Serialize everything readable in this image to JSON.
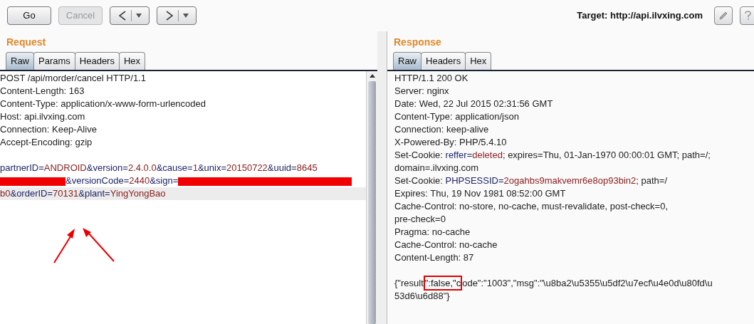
{
  "toolbar": {
    "buttons": [
      {
        "label": "Go",
        "disabled": false
      },
      {
        "label": "Cancel",
        "disabled": true
      }
    ],
    "target": "Target: http://api.ilvxing.com"
  },
  "request": {
    "title": "Request",
    "tabs": [
      {
        "label": "Raw",
        "selected": true
      },
      {
        "label": "Params",
        "selected": false
      },
      {
        "label": "Headers",
        "selected": false
      },
      {
        "label": "Hex",
        "selected": false
      }
    ],
    "lines": [
      {
        "segments": [
          {
            "kind": "plain",
            "text": "POST /api/morder/cancel HTTP/1.1"
          }
        ]
      },
      {
        "segments": [
          {
            "kind": "plain",
            "text": "Content-Length: 163"
          }
        ]
      },
      {
        "segments": [
          {
            "kind": "plain",
            "text": "Content-Type: application/x-www-form-urlencoded"
          }
        ]
      },
      {
        "segments": [
          {
            "kind": "plain",
            "text": "Host: api.ilvxing.com"
          }
        ]
      },
      {
        "segments": [
          {
            "kind": "plain",
            "text": "Connection: Keep-Alive"
          }
        ]
      },
      {
        "segments": [
          {
            "kind": "plain",
            "text": "Accept-Encoding: gzip"
          }
        ]
      },
      {
        "kind": "blank"
      },
      {
        "segments": [
          {
            "kind": "name",
            "text": "partnerID="
          },
          {
            "kind": "value",
            "text": "ANDROID"
          },
          {
            "kind": "name",
            "text": "&version="
          },
          {
            "kind": "value",
            "text": "2.4.0.0"
          },
          {
            "kind": "name",
            "text": "&cause="
          },
          {
            "kind": "value",
            "text": "1"
          },
          {
            "kind": "name",
            "text": "&unix="
          },
          {
            "kind": "value",
            "text": "20150722"
          },
          {
            "kind": "name",
            "text": "&uuid="
          },
          {
            "kind": "value",
            "text": "8645"
          }
        ]
      },
      {
        "segments": [
          {
            "kind": "redaction"
          },
          {
            "kind": "name",
            "text": "&versionCode="
          },
          {
            "kind": "value",
            "text": "2440"
          },
          {
            "kind": "name",
            "text": "&sign="
          },
          {
            "kind": "redaction"
          }
        ]
      },
      {
        "highlighted": true,
        "segments": [
          {
            "kind": "value",
            "text": "b0"
          },
          {
            "kind": "name",
            "text": "&orderID="
          },
          {
            "kind": "value",
            "text": "70131"
          },
          {
            "kind": "name",
            "text": "&plant="
          },
          {
            "kind": "value",
            "text": "YingYongBao"
          }
        ]
      }
    ]
  },
  "response": {
    "title": "Response",
    "tabs": [
      {
        "label": "Raw",
        "selected": true
      },
      {
        "label": "Headers",
        "selected": false
      },
      {
        "label": "Hex",
        "selected": false
      }
    ],
    "lines": [
      {
        "segments": [
          {
            "kind": "plain",
            "text": "HTTP/1.1 200 OK"
          }
        ]
      },
      {
        "segments": [
          {
            "kind": "plain",
            "text": "Server: nginx"
          }
        ]
      },
      {
        "segments": [
          {
            "kind": "plain",
            "text": "Date: Wed, 22 Jul 2015 02:31:56 GMT"
          }
        ]
      },
      {
        "segments": [
          {
            "kind": "plain",
            "text": "Content-Type: application/json"
          }
        ]
      },
      {
        "segments": [
          {
            "kind": "plain",
            "text": "Connection: keep-alive"
          }
        ]
      },
      {
        "segments": [
          {
            "kind": "plain",
            "text": "X-Powered-By: PHP/5.4.10"
          }
        ]
      },
      {
        "segments": [
          {
            "kind": "plain",
            "text": "Set-Cookie: "
          },
          {
            "kind": "name",
            "text": "reffer="
          },
          {
            "kind": "value",
            "text": "deleted"
          },
          {
            "kind": "plain",
            "text": "; expires=Thu, 01-Jan-1970 00:00:01 GMT; path=/;"
          }
        ]
      },
      {
        "segments": [
          {
            "kind": "plain",
            "text": "domain=.ilvxing.com"
          }
        ]
      },
      {
        "segments": [
          {
            "kind": "plain",
            "text": "Set-Cookie: "
          },
          {
            "kind": "name",
            "text": "PHPSESSID="
          },
          {
            "kind": "value",
            "text": "2ogahbs9makvemr6e8op93bin2"
          },
          {
            "kind": "plain",
            "text": "; path=/"
          }
        ]
      },
      {
        "segments": [
          {
            "kind": "plain",
            "text": "Expires: Thu, 19 Nov 1981 08:52:00 GMT"
          }
        ]
      },
      {
        "segments": [
          {
            "kind": "plain",
            "text": "Cache-Control: no-store, no-cache, must-revalidate, post-check=0,"
          }
        ]
      },
      {
        "segments": [
          {
            "kind": "plain",
            "text": "pre-check=0"
          }
        ]
      },
      {
        "segments": [
          {
            "kind": "plain",
            "text": "Pragma: no-cache"
          }
        ]
      },
      {
        "segments": [
          {
            "kind": "plain",
            "text": "Cache-Control: no-cache"
          }
        ]
      },
      {
        "segments": [
          {
            "kind": "plain",
            "text": "Content-Length: 87"
          }
        ]
      },
      {
        "kind": "blank"
      },
      {
        "segments": [
          {
            "kind": "plain",
            "text": "{\"result"
          },
          {
            "kind": "boxed",
            "text": "\":false,\"c"
          },
          {
            "kind": "plain",
            "text": "ode\":\"1003\",\"msg\":\"\\u8ba2\\u5355\\u5df2\\u7ecf\\u4e0d\\u80fd\\u"
          }
        ]
      },
      {
        "segments": [
          {
            "kind": "plain",
            "text": "53d6\\u6d88\"}"
          }
        ]
      }
    ]
  }
}
